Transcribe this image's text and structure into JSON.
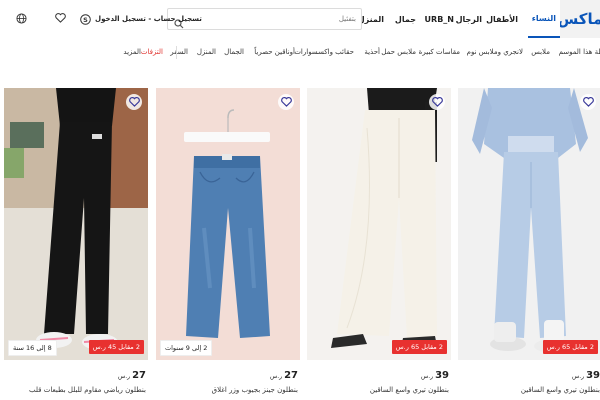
{
  "header": {
    "logo": "ماكس",
    "tabs": [
      {
        "label": "النساء",
        "active": true
      },
      {
        "label": "الأطفال",
        "active": false
      },
      {
        "label": "الرجال",
        "active": false
      },
      {
        "label": "URB_N",
        "active": false
      },
      {
        "label": "جمال",
        "active": false
      },
      {
        "label": "المنزل",
        "active": false
      }
    ],
    "search_placeholder": "بتفئيل",
    "account_label": "تسجيل حساب - تسجيل الدخول",
    "icons": [
      "search-icon",
      "user-icon",
      "heart-icon",
      "globe-icon"
    ]
  },
  "categories": [
    "وصلة هذا الموسم",
    "ملابس",
    "لانجري وملابس نوم",
    "مقاسات كبيرة",
    "ملابس حمل",
    "أحذية",
    "حقائب واكسسوارات",
    "أوناقين حصرياً",
    "الجمال",
    "المنزل",
    "السفر",
    "التزفات",
    "المزيد"
  ],
  "products": [
    {
      "price": "39",
      "currency": "ر.س",
      "name": "بنطلون تيري واسع الساقين",
      "offer": "2 مقابل 65 ر.س",
      "age": "",
      "colors": {
        "bg": "#f1f1f1",
        "item": "#b7cce6"
      }
    },
    {
      "price": "39",
      "currency": "ر.س",
      "name": "بنطلون تيري واسع الساقين",
      "offer": "2 مقابل 65 ر.س",
      "age": "",
      "colors": {
        "bg": "#f4f2ef",
        "item": "#f3efe6"
      }
    },
    {
      "price": "27",
      "currency": "ر.س",
      "name": "بنطلون جينز بجيوب وزر اغلاق",
      "offer": "",
      "age": "2 إلى 9 سنوات",
      "colors": {
        "bg": "#f3ddd6",
        "item": "#4f7fb3"
      }
    },
    {
      "price": "27",
      "currency": "ر.س",
      "name": "بنطلون رياضي مقاوم للبلل بطبعات قلب",
      "offer": "2 مقابل 45 ر.س",
      "age": "8 إلى 16 سنة",
      "colors": {
        "bg": "#d9d3c8",
        "item": "#151515"
      }
    }
  ]
}
